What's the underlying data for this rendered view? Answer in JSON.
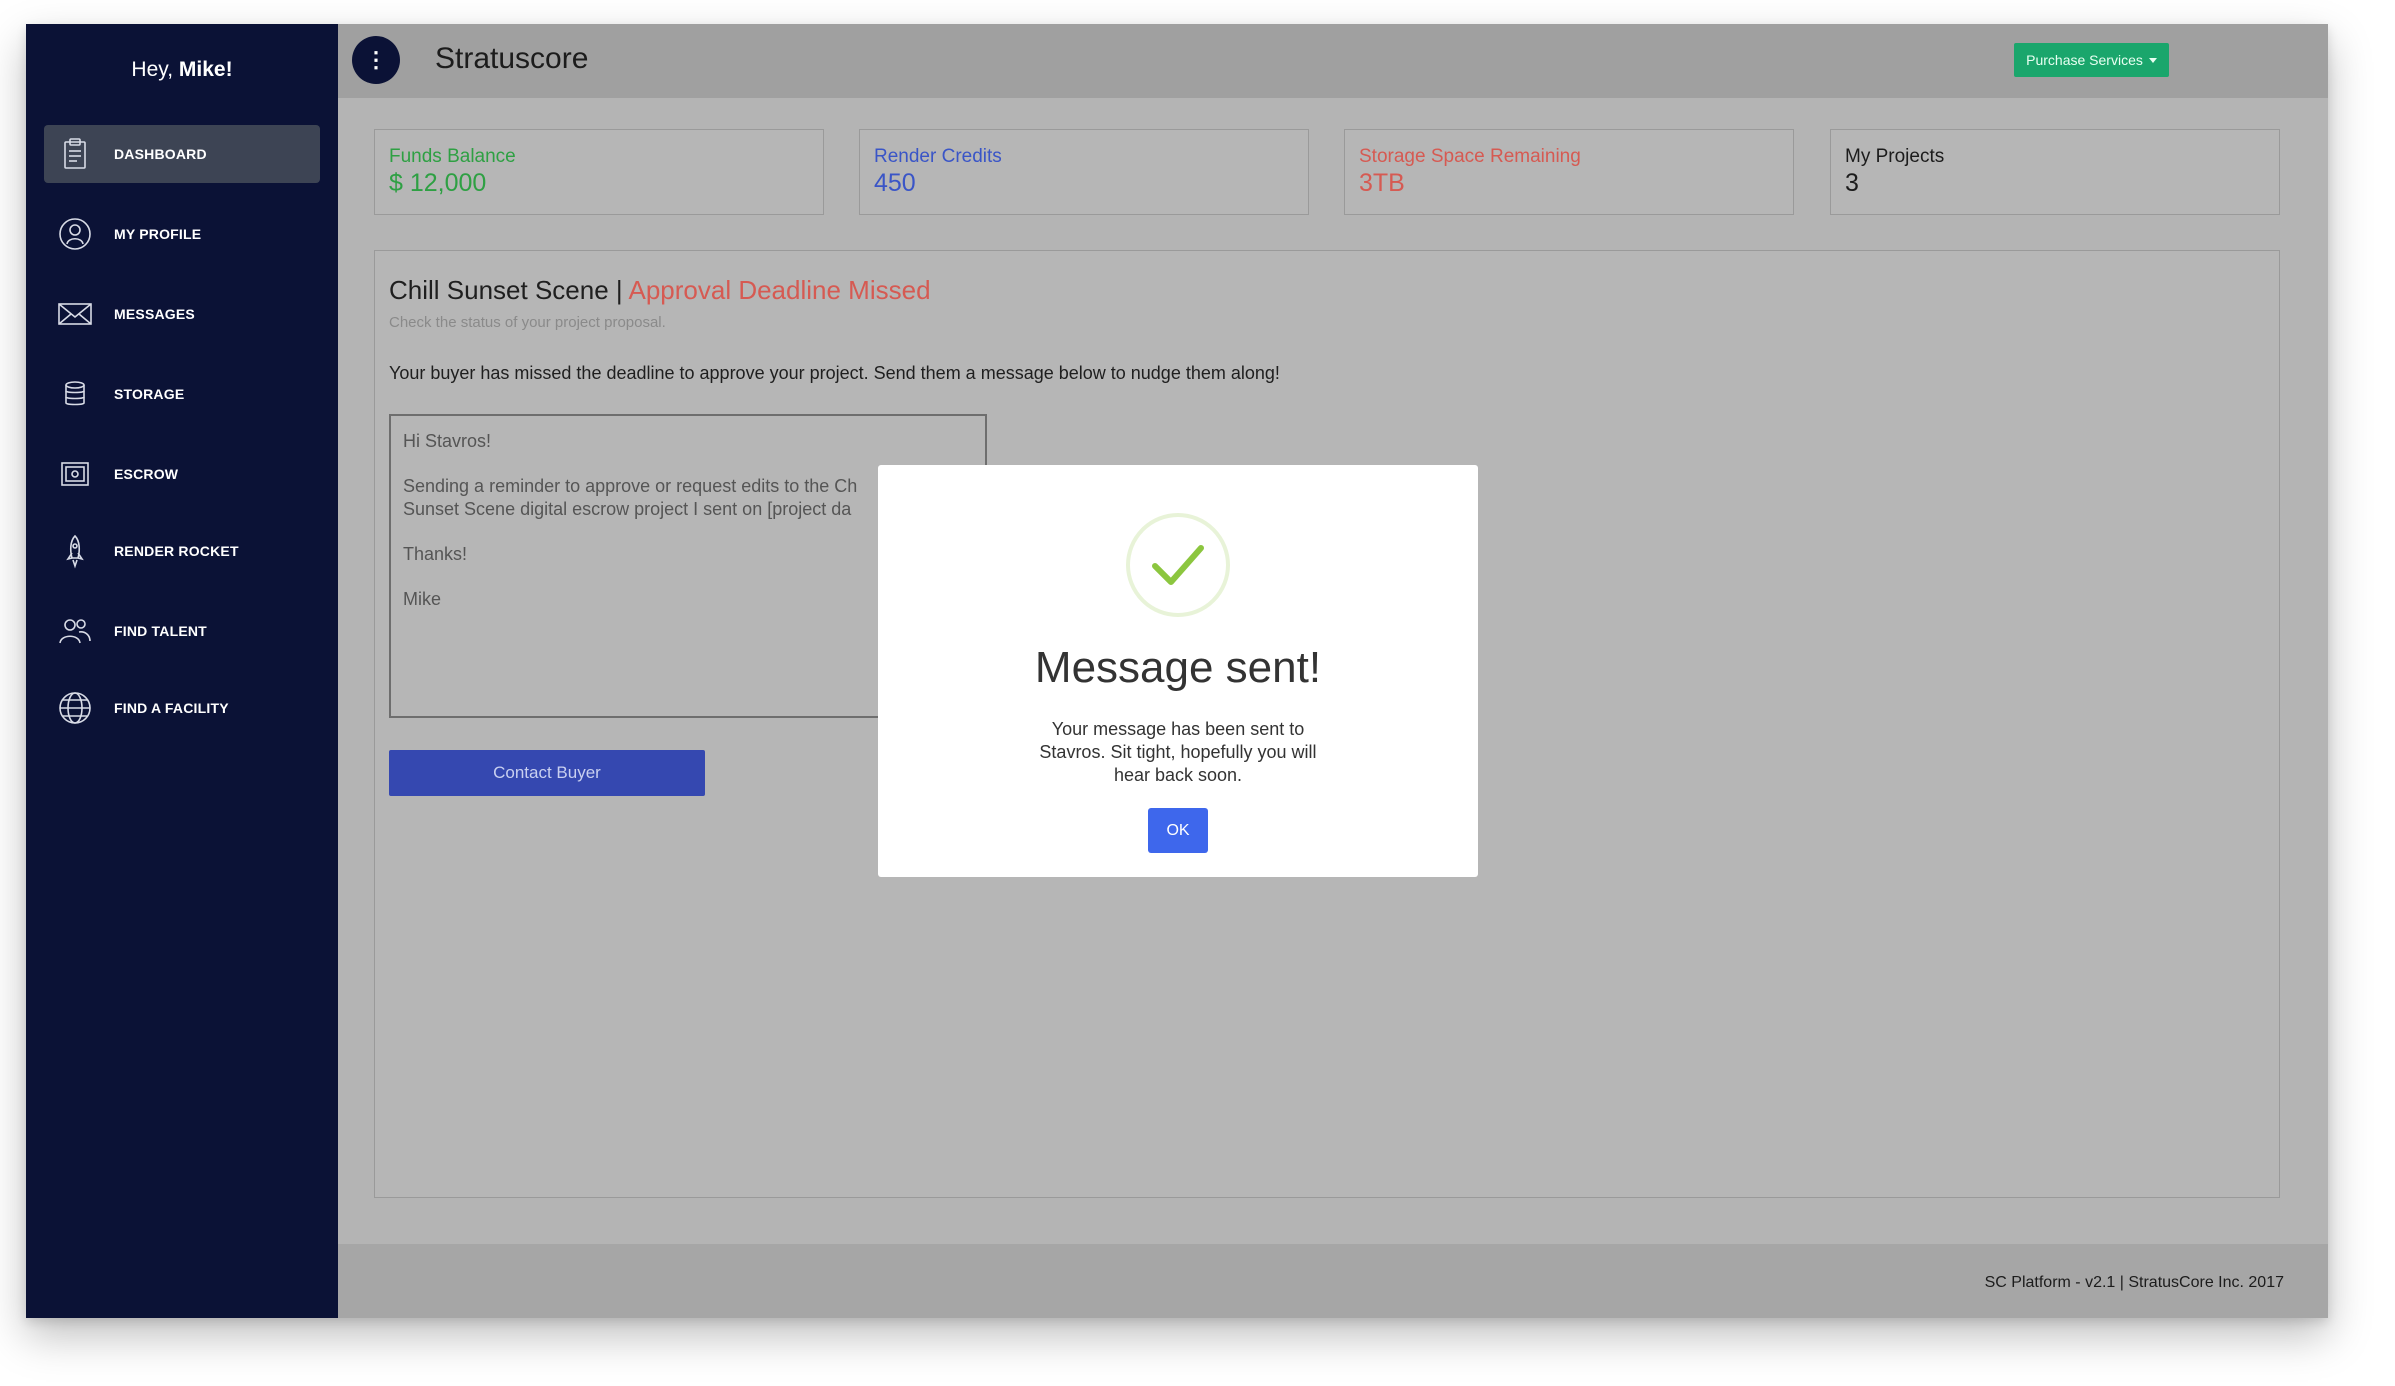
{
  "sidebar": {
    "greeting_prefix": "Hey,",
    "greeting_name": "Mike!",
    "items": [
      {
        "label": "DASHBOARD",
        "icon": "clipboard-icon"
      },
      {
        "label": "MY PROFILE",
        "icon": "user-icon"
      },
      {
        "label": "MESSAGES",
        "icon": "envelope-icon"
      },
      {
        "label": "STORAGE",
        "icon": "database-icon"
      },
      {
        "label": "ESCROW",
        "icon": "safe-icon"
      },
      {
        "label": "RENDER ROCKET",
        "icon": "rocket-icon"
      },
      {
        "label": "FIND TALENT",
        "icon": "users-icon"
      },
      {
        "label": "FIND A FACILITY",
        "icon": "globe-icon"
      }
    ],
    "active_item": "DASHBOARD"
  },
  "header": {
    "title": "Stratuscore",
    "menu_icon": "vertical-dots-icon",
    "purchase_label": "Purchase Services"
  },
  "stats": [
    {
      "label": "Funds Balance",
      "value": "$ 12,000",
      "color": "#2ea043"
    },
    {
      "label": "Render Credits",
      "value": "450",
      "color": "#3a55c7"
    },
    {
      "label": "Storage Space Remaining",
      "value": "3TB",
      "color": "#d65a52"
    },
    {
      "label": "My Projects",
      "value": "3",
      "color": "#1c1c1c"
    }
  ],
  "project": {
    "title": "Chill Sunset Scene",
    "separator": "|",
    "status": "Approval Deadline Missed",
    "subtitle": "Check the status of your project proposal.",
    "instruction": "Your buyer has missed the deadline to approve your project. Send them a message below to nudge them along!",
    "message_lines": {
      "greeting": "Hi Stavros!",
      "body_1": "Sending a reminder to approve or request edits to the Ch",
      "body_2": "Sunset Scene digital escrow project I sent on [project da",
      "thanks": "Thanks!",
      "sign": "Mike"
    },
    "contact_button": "Contact Buyer"
  },
  "modal": {
    "icon": "checkmark-icon",
    "title": "Message sent!",
    "text": "Your message has been sent to Stavros. Sit tight, hopefully you will hear back soon.",
    "ok_label": "OK"
  },
  "footer": {
    "text": "SC Platform - v2.1 | StratusCore Inc. 2017"
  },
  "colors": {
    "sidebar_bg": "#0b1236",
    "accent_green": "#1aa66c",
    "accent_blue": "#3e67ec",
    "status_red": "#d65a52"
  }
}
